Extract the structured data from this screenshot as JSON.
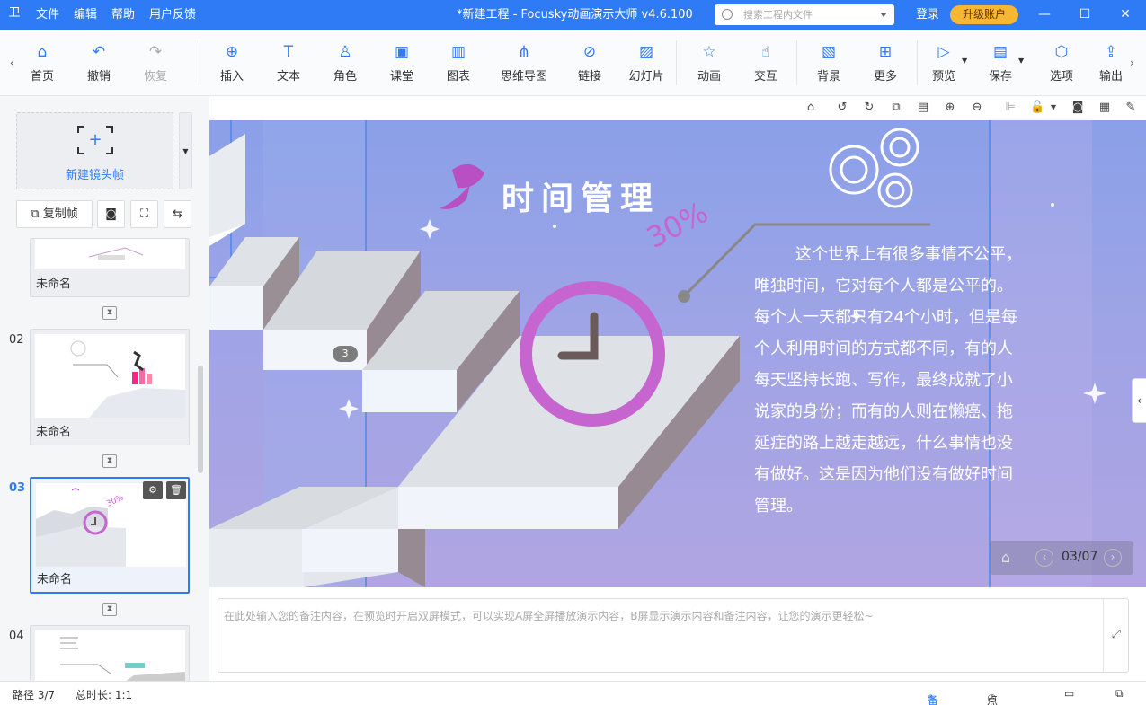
{
  "titlebar": {
    "logo": "卫",
    "menus": [
      "文件",
      "编辑",
      "帮助",
      "用户反馈"
    ],
    "app_title": "*新建工程 - Focusky动画演示大师  v4.6.100",
    "search_placeholder": "搜索工程内文件",
    "login": "登录",
    "upgrade": "升级账户",
    "win_min": "—",
    "win_max": "☐",
    "win_close": "✕"
  },
  "toolbar": {
    "items": [
      {
        "label": "首页",
        "icon": "home-icon"
      },
      {
        "label": "撤销",
        "icon": "undo-icon"
      },
      {
        "label": "恢复",
        "icon": "redo-icon"
      },
      {
        "label": "插入",
        "icon": "insert-icon"
      },
      {
        "label": "文本",
        "icon": "text-icon"
      },
      {
        "label": "角色",
        "icon": "role-icon"
      },
      {
        "label": "课堂",
        "icon": "classroom-icon"
      },
      {
        "label": "图表",
        "icon": "chart-icon"
      },
      {
        "label": "思维导图",
        "icon": "mindmap-icon"
      },
      {
        "label": "链接",
        "icon": "link-icon"
      },
      {
        "label": "幻灯片",
        "icon": "slide-icon"
      },
      {
        "label": "动画",
        "icon": "animation-icon"
      },
      {
        "label": "交互",
        "icon": "interaction-icon"
      },
      {
        "label": "背景",
        "icon": "background-icon"
      },
      {
        "label": "更多",
        "icon": "more-icon"
      },
      {
        "label": "预览",
        "icon": "preview-icon"
      },
      {
        "label": "保存",
        "icon": "save-icon"
      },
      {
        "label": "选项",
        "icon": "options-icon"
      },
      {
        "label": "输出",
        "icon": "export-icon"
      }
    ]
  },
  "left_panel": {
    "new_frame_label": "新建镜头帧",
    "copy_frame_label": "复制帧",
    "slides": [
      {
        "num": "",
        "name": "未命名"
      },
      {
        "num": "02",
        "name": "未命名"
      },
      {
        "num": "03",
        "name": "未命名"
      },
      {
        "num": "04",
        "name": ""
      }
    ]
  },
  "slide": {
    "title": "时间管理",
    "percent": "30%",
    "paragraph": [
      "这个世界上有很多事情不公平，",
      "唯独时间，它对每个人都是公平的。",
      "每个人一天都只有24个小时，但是每",
      "个人利用时间的方式都不同，有的人",
      "每天坚持长跑、写作，最终成就了小",
      "说家的身份；而有的人则在懒癌、拖",
      "延症的路上越走越远，什么事情也没",
      "有做好。这是因为他们没有做好时间",
      "管理。"
    ],
    "frame_badge": "3",
    "nav_counter": "03/07"
  },
  "notes": {
    "placeholder": "在此处输入您的备注内容，在预览时开启双屏模式，可以实现A屏全屏播放演示内容，B屏显示演示内容和备注内容，让您的演示更轻松~"
  },
  "status": {
    "path": "路径 3/7",
    "duration": "总时长: 1:1",
    "notes_btn": "备注",
    "rollcall_btn": "点名"
  },
  "colors": {
    "accent": "#2f7bf6",
    "clock_ring": "#c665d0",
    "upgrade_bg": "#f7b733"
  }
}
